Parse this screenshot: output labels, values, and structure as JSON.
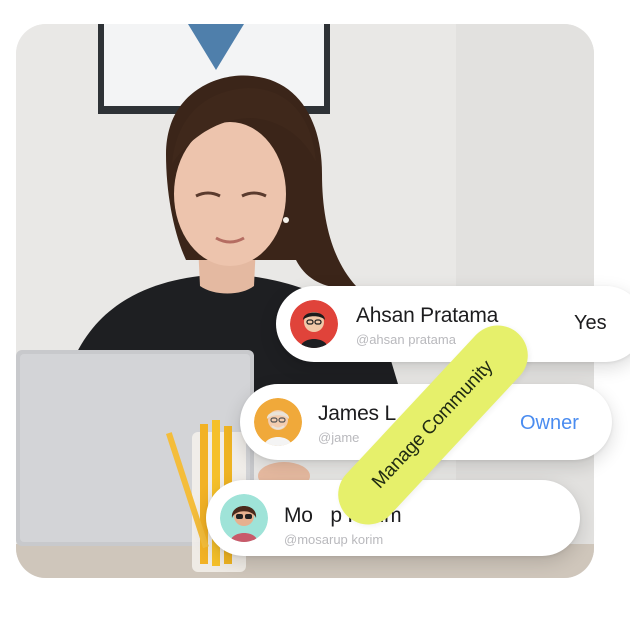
{
  "users": [
    {
      "name": "Ahsan Pratama",
      "handle": "@ahsan pratama",
      "role": "Yes",
      "role_color": "#1c1c1e",
      "avatar_bg": "#e0433a"
    },
    {
      "name": "James L",
      "handle": "@jame",
      "role": "Owner",
      "role_color": "#4a8cf0",
      "avatar_bg": "#f0a93a"
    },
    {
      "name": "Mo    p Korim",
      "handle": "@mosarup korim",
      "role": "",
      "role_color": "#1c1c1e",
      "avatar_bg": "#9fe3d8"
    }
  ],
  "badge": {
    "label": "Manage Community",
    "color": "#e6f06b"
  },
  "colors": {
    "card": "#ffffff",
    "name_text": "#1c1c1e",
    "handle_text": "#b9b9bd"
  }
}
